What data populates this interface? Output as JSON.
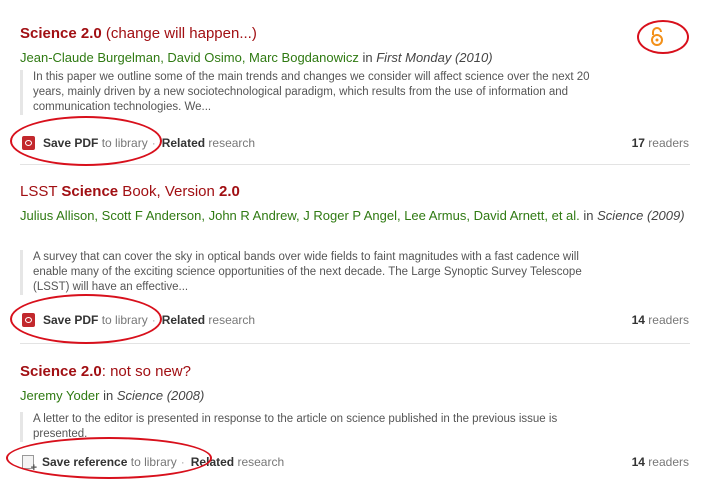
{
  "results": [
    {
      "title_bold": "Science 2.0",
      "title_rest": " (change will happen...)",
      "authors": "Jean-Claude Burgelman, David Osimo, Marc Bogdanowicz",
      "in_word": " in ",
      "journal": "First Monday (2010)",
      "abstract": "In this paper we outline some of the main trends and changes we consider will affect science over the next 20 years, mainly driven by a new sociotechnological paradigm, which results from the use of information and communication technologies. We...",
      "save_bold": "Save PDF",
      "save_rest": " to library",
      "related_bold": "Related",
      "related_rest": " research",
      "readers_count": "17",
      "readers_label": " readers",
      "save_icon": "pdf-icon"
    },
    {
      "title_pre": "LSST ",
      "title_bold": "Science",
      "title_mid": " Book, Version ",
      "title_bold2": "2.0",
      "authors": "Julius Allison, Scott F Anderson, John R Andrew, J Roger P Angel, Lee Armus, David Arnett, et al.",
      "in_word": " in ",
      "journal": "Science (2009)",
      "abstract": "A survey that can cover the sky in optical bands over wide fields to faint magnitudes with a fast cadence will enable many of the exciting science opportunities of the next decade. The Large Synoptic Survey Telescope (LSST) will have an effective...",
      "save_bold": "Save PDF",
      "save_rest": " to library",
      "related_bold": "Related",
      "related_rest": " research",
      "readers_count": "14",
      "readers_label": " readers",
      "save_icon": "pdf-icon"
    },
    {
      "title_bold": "Science 2.0",
      "title_rest": ": not so new?",
      "authors": "Jeremy Yoder",
      "in_word": " in ",
      "journal": "Science (2008)",
      "abstract": "A letter to the editor is presented in response to the article on science published in the previous issue is presented.",
      "save_bold": "Save reference",
      "save_rest": " to library",
      "related_bold": "Related",
      "related_rest": " research",
      "readers_count": "14",
      "readers_label": " readers",
      "save_icon": "reference-icon"
    }
  ],
  "colors": {
    "title": "#a10f13",
    "authors": "#2f7a12",
    "annotation_oval": "#d8101c",
    "open_access": "#f39019"
  },
  "open_access_icon": "open-access-lock-icon"
}
